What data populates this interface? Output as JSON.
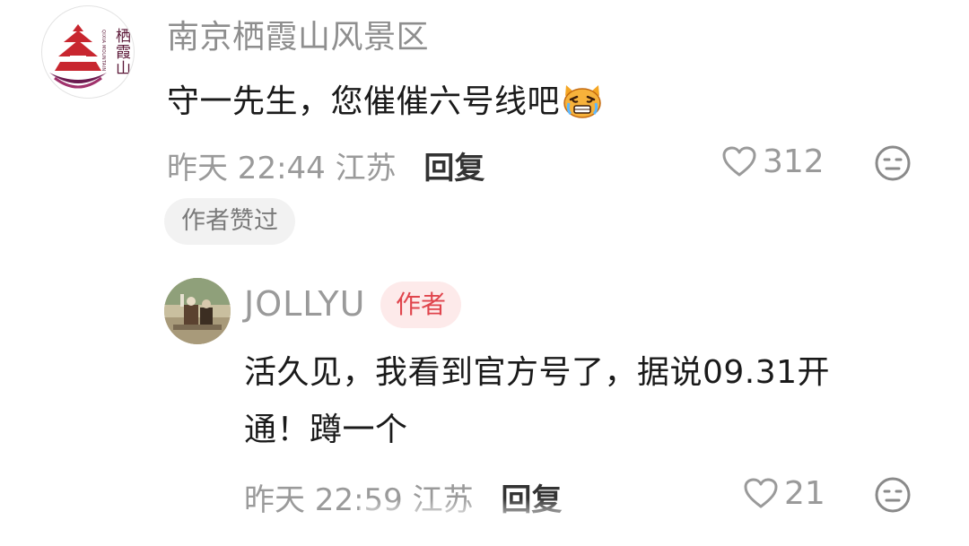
{
  "comment": {
    "author": "南京栖霞山风景区",
    "avatar_logo_text": "栖霞山",
    "avatar_logo_subtext": "QIXIA MOUNTAIN",
    "text": "守一先生，您催催六号线吧",
    "emoji": "crying-cat-emoji",
    "time": "昨天 22:44",
    "location": "江苏",
    "reply_label": "回复",
    "like_count": "312",
    "author_liked_badge": "作者赞过",
    "colors": {
      "logo_red": "#c8262f",
      "logo_purple": "#6b1b4f"
    }
  },
  "reply": {
    "author": "JOLLYU",
    "author_badge": "作者",
    "text_line1": "活久见，我看到官方号了，据说09.31开",
    "text_line2": "通！蹲一个",
    "time": "昨天 22:59",
    "location": "江苏",
    "reply_label": "回复",
    "like_count": "21",
    "colors": {
      "badge_bg": "#fdeaea",
      "badge_text": "#e0454d"
    }
  },
  "icons": {
    "like": "heart-outline-icon",
    "dislike": "meh-face-icon"
  }
}
